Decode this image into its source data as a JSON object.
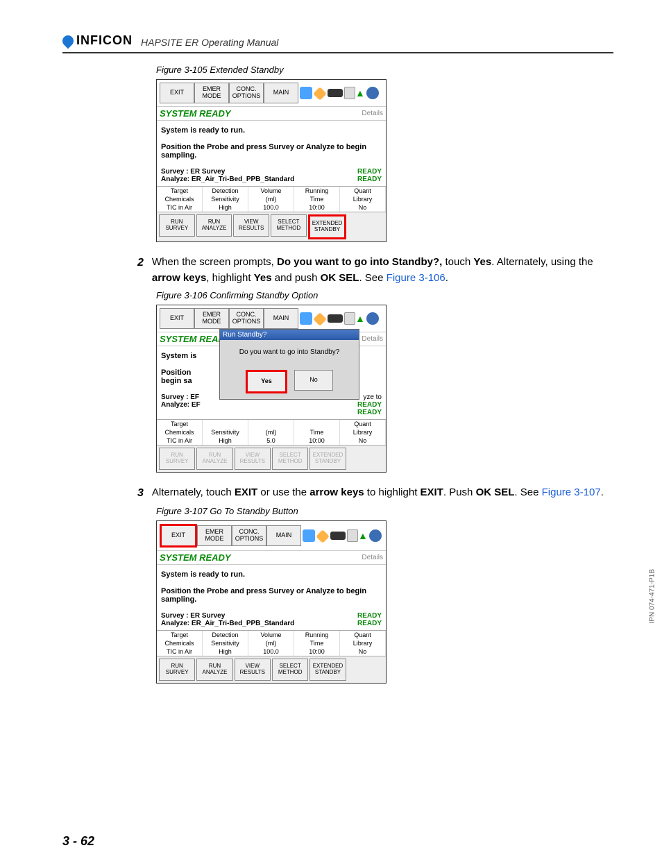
{
  "header": {
    "brand": "INFICON",
    "manual": "HAPSITE ER Operating Manual"
  },
  "page_num": "3 - 62",
  "side": "IPN 074-471-P1B",
  "fig105": {
    "cap": "Figure 3-105  Extended Standby"
  },
  "fig106": {
    "cap": "Figure 3-106  Confirming Standby Option"
  },
  "fig107": {
    "cap": "Figure 3-107  Go To Standby Button"
  },
  "toolbar": {
    "exit": "EXIT",
    "emer": "EMER MODE",
    "conc": "CONC. OPTIONS",
    "main": "MAIN"
  },
  "status": {
    "ready": "SYSTEM READY",
    "details": "Details"
  },
  "msg": {
    "l1": "System is ready to run.",
    "l2": "Position the Probe and press Survey or Analyze to begin sampling.",
    "l2a": "Position",
    "l2b": "begin sa",
    "l1s": "System is"
  },
  "mode": {
    "s": "Survey : ER Survey",
    "a": "Analyze: ER_Air_Tri-Bed_PPB_Standard",
    "ss": "Survey : EF",
    "as": "Analyze: EF",
    "r": "READY"
  },
  "tbl": {
    "h": [
      "Target",
      "Detection",
      "Volume",
      "Running",
      "Quant"
    ],
    "r1": [
      "Chemicals",
      "Sensitivity",
      "(ml)",
      "Time",
      "Library"
    ],
    "r2a": [
      "TIC in Air",
      "High",
      "100.0",
      "10:00",
      "No"
    ],
    "r2b": [
      "TIC in Air",
      "High",
      "5.0",
      "10:00",
      "No"
    ],
    "r2c": [
      "TIC in Air",
      "High",
      "100.0",
      "10:00",
      "No"
    ]
  },
  "foot": {
    "rs": "RUN SURVEY",
    "ra": "RUN ANALYZE",
    "vr": "VIEW RESULTS",
    "sm": "SELECT METHOD",
    "es": "EXTENDED STANDBY"
  },
  "dialog": {
    "title": "Run Standby?",
    "msg": "Do you want to go into Standby?",
    "yes": "Yes",
    "no": "No"
  },
  "step2": {
    "n": "2",
    "t1": "When the screen prompts, ",
    "b1": "Do you want to go into Standby?,",
    "t2": " touch ",
    "b2": "Yes",
    "t3": ". Alternately, using the ",
    "b3": "arrow keys",
    "t4": ", highlight ",
    "b4": "Yes",
    "t5": " and push ",
    "b5": "OK SEL",
    "t6": ". See ",
    "link": "Figure 3-106",
    "t7": "."
  },
  "step3": {
    "n": "3",
    "t1": "Alternately, touch ",
    "b1": "EXIT",
    "t2": " or use the ",
    "b2": "arrow keys",
    "t3": " to highlight ",
    "b3": "EXIT",
    "t4": ". Push ",
    "b4": "OK SEL",
    "t5": ". See ",
    "link": "Figure 3-107",
    "t6": "."
  }
}
